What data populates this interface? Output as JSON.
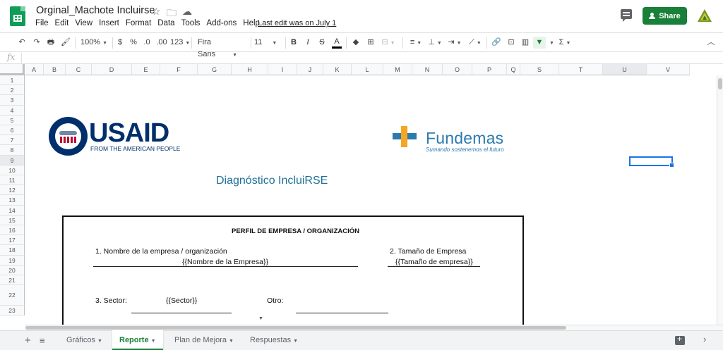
{
  "app": {
    "doc_title": "Orginal_Machote Incluirse",
    "last_edit": "Last edit was on July 1",
    "share_label": "Share"
  },
  "menu": [
    "File",
    "Edit",
    "View",
    "Insert",
    "Format",
    "Data",
    "Tools",
    "Add-ons",
    "Help"
  ],
  "toolbar": {
    "zoom": "100%",
    "currency": "$",
    "percent": "%",
    "dec_decrease": ".0",
    "dec_increase": ".00",
    "more_formats": "123",
    "font": "Fira Sans",
    "font_size": "11",
    "bold": "B",
    "italic": "I",
    "strike": "S",
    "text_color": "A",
    "functions": "Σ"
  },
  "formula_bar": {
    "fx": "fx"
  },
  "columns": [
    "A",
    "B",
    "C",
    "D",
    "E",
    "F",
    "G",
    "H",
    "I",
    "J",
    "K",
    "L",
    "M",
    "N",
    "O",
    "P",
    "Q",
    "S",
    "T",
    "U",
    "V"
  ],
  "rows": [
    "1",
    "2",
    "3",
    "4",
    "5",
    "6",
    "7",
    "8",
    "9",
    "10",
    "11",
    "12",
    "13",
    "14",
    "15",
    "16",
    "17",
    "18",
    "19",
    "20",
    "21",
    "22",
    "23"
  ],
  "logos": {
    "usaid_word": "USAID",
    "usaid_sub": "FROM THE AMERICAN PEOPLE",
    "fundemas_word": "Fundemas",
    "fundemas_tag": "Sumando sostenemos el futuro"
  },
  "report": {
    "title": "Diagnóstico IncluiRSE",
    "heading": "PERFIL DE EMPRESA / ORGANIZACIÓN",
    "field1_label": "1. Nombre de la empresa / organización",
    "field1_value": "{{Nombre de la Empresa}}",
    "field2_label": "2. Tamaño de Empresa",
    "field2_value": "{{Tamaño de empresa}}",
    "field3_label": "3. Sector:",
    "field3_value": "{{Sector}}",
    "other_label": "Otro:"
  },
  "tabs": [
    {
      "label": "Gráficos",
      "active": false
    },
    {
      "label": "Reporte",
      "active": true
    },
    {
      "label": "Plan de Mejora",
      "active": false
    },
    {
      "label": "Respuestas",
      "active": false
    }
  ],
  "colors": {
    "accent": "#188038",
    "selection": "#1a73e8",
    "title_blue": "#1f6f9a"
  }
}
